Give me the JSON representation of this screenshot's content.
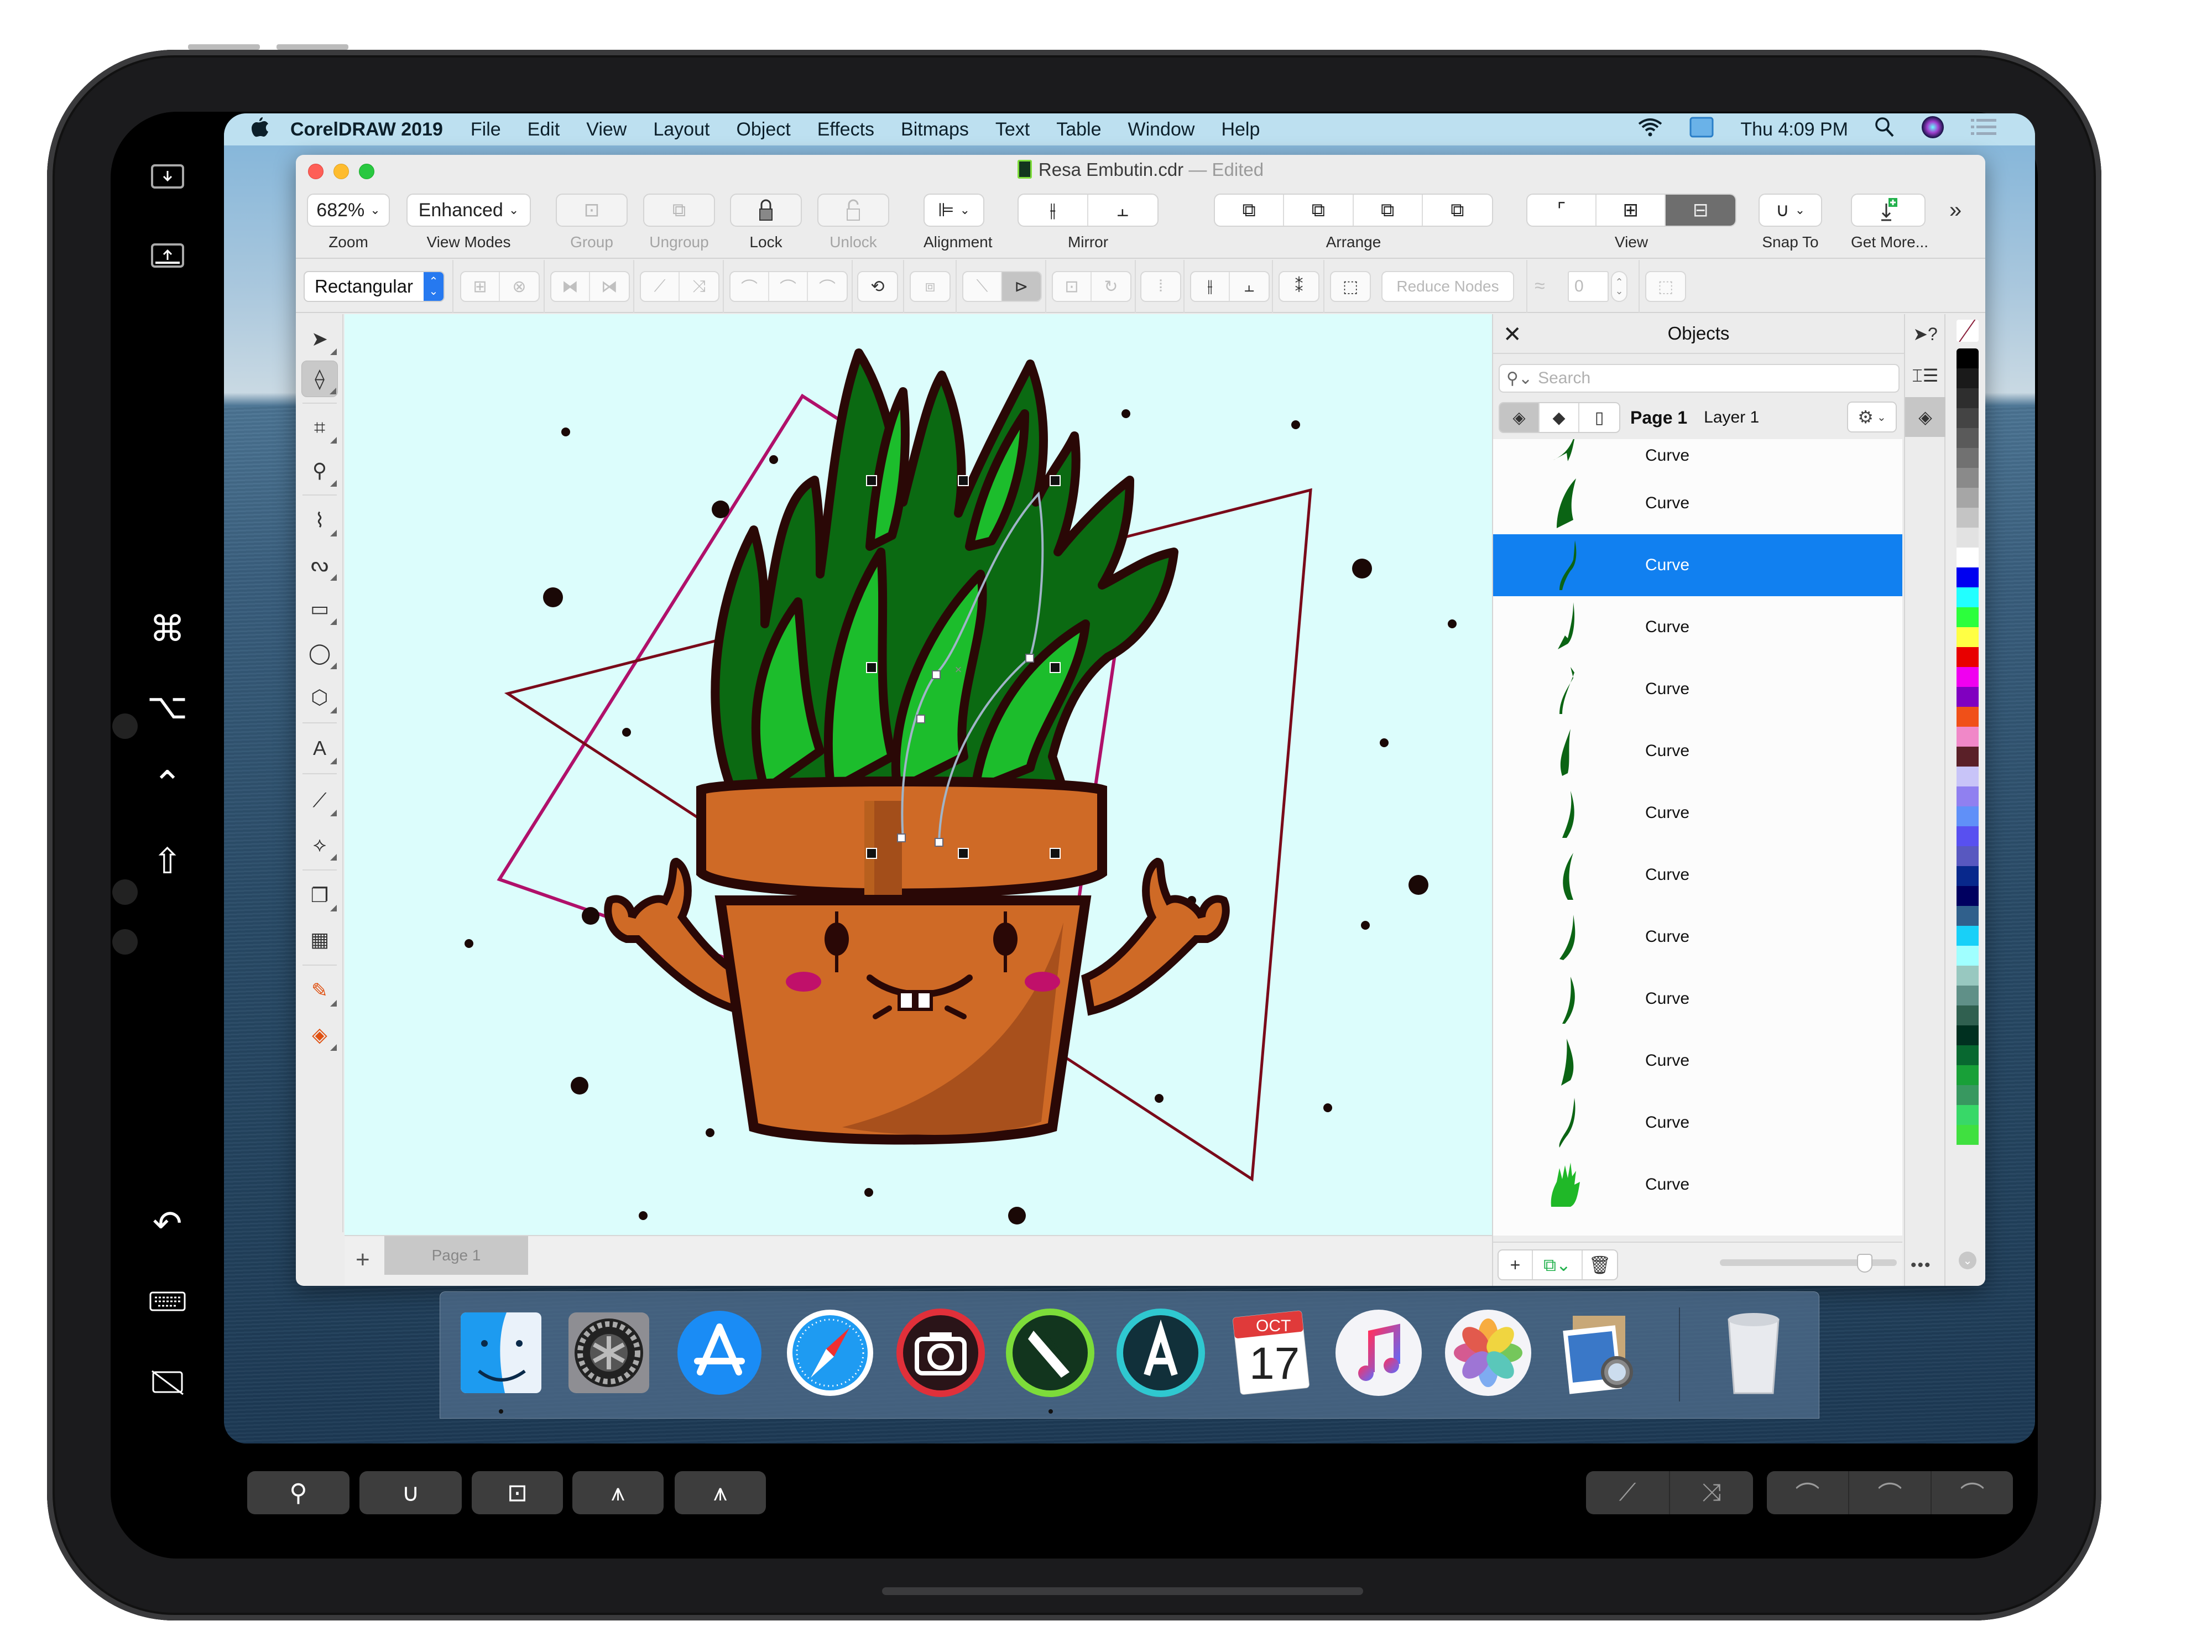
{
  "menubar": {
    "app_name": "CorelDRAW 2019",
    "items": [
      "File",
      "Edit",
      "View",
      "Layout",
      "Object",
      "Effects",
      "Bitmaps",
      "Text",
      "Table",
      "Window",
      "Help"
    ],
    "clock": "Thu 4:09 PM",
    "status_icons": [
      "wifi-icon",
      "display-icon",
      "spotlight-search-icon",
      "siri-icon",
      "notification-center-icon"
    ]
  },
  "window": {
    "document_name": "Resa Embutin.cdr",
    "separator": "—",
    "status": "Edited"
  },
  "toolbar": {
    "zoom_value": "682%",
    "zoom_label": "Zoom",
    "view_mode_value": "Enhanced",
    "view_modes_label": "View Modes",
    "group_label": "Group",
    "ungroup_label": "Ungroup",
    "lock_label": "Lock",
    "unlock_label": "Unlock",
    "alignment_label": "Alignment",
    "mirror_label": "Mirror",
    "arrange_label": "Arrange",
    "view_label": "View",
    "snap_label": "Snap To",
    "get_more_label": "Get More...",
    "overflow": "»"
  },
  "propbar": {
    "selection_mode": "Rectangular",
    "reduce_nodes_label": "Reduce Nodes",
    "smoothness_value": "0"
  },
  "canvas": {
    "background": "#dcfdfc",
    "page_tab": "Page 1",
    "add_page": "+"
  },
  "docker": {
    "title": "Objects",
    "close": "✕",
    "search_placeholder": "Search",
    "page_label": "Page 1",
    "layer_label": "Layer 1",
    "objects": [
      {
        "name": "Curve",
        "selected": false
      },
      {
        "name": "Curve",
        "selected": false
      },
      {
        "name": "Curve",
        "selected": true
      },
      {
        "name": "Curve",
        "selected": false
      },
      {
        "name": "Curve",
        "selected": false
      },
      {
        "name": "Curve",
        "selected": false
      },
      {
        "name": "Curve",
        "selected": false
      },
      {
        "name": "Curve",
        "selected": false
      },
      {
        "name": "Curve",
        "selected": false
      },
      {
        "name": "Curve",
        "selected": false
      },
      {
        "name": "Curve",
        "selected": false
      },
      {
        "name": "Curve",
        "selected": false
      },
      {
        "name": "Curve",
        "selected": false
      }
    ],
    "thumbnail_zoom": 0.85,
    "more": "•••"
  },
  "palette": {
    "colors": [
      "#000000",
      "#1a1a1a",
      "#2e2e2e",
      "#444444",
      "#5a5a5a",
      "#717171",
      "#8a8a8a",
      "#a6a6a6",
      "#c4c4c4",
      "#e2e2e2",
      "#ffffff",
      "#0000f0",
      "#22ffff",
      "#2cff3c",
      "#ffff44",
      "#e80000",
      "#f000f0",
      "#8000c0",
      "#f05018",
      "#f088c8",
      "#5a2028",
      "#c8c4f8",
      "#9080f0",
      "#6090f8",
      "#5850f0",
      "#5858c0",
      "#08288c",
      "#000060",
      "#30608c",
      "#18d0f8",
      "#a0ffff",
      "#98c8c0",
      "#609088",
      "#306050",
      "#003020",
      "#086830",
      "#18a038",
      "#389860",
      "#38d868",
      "#40e040"
    ]
  },
  "accent_colors": {
    "selection_blue": "#1180f0",
    "pot_orange": "#cf6a26",
    "leaf_green": "#1cbd2c",
    "leaf_dark": "#0b6a12",
    "outline": "#2a0806",
    "frame_magenta": "#b0106a"
  },
  "dock": {
    "apps": [
      "Finder",
      "System Preferences",
      "App Store",
      "Safari",
      "Photo Booth",
      "CorelDRAW",
      "Font Manager",
      "Calendar",
      "iTunes",
      "Photos",
      "Preview",
      "Trash"
    ],
    "calendar_month": "OCT",
    "calendar_day": "17"
  },
  "sidecar": {
    "icons": [
      "show-menu-bar-icon",
      "show-dock-icon",
      "command-key-icon",
      "option-key-icon",
      "control-key-icon",
      "shift-key-icon",
      "undo-icon",
      "keyboard-icon",
      "disconnect-icon"
    ]
  },
  "touchbar": {
    "left_keys": [
      "zoom-tool-icon",
      "snap-magnet-icon",
      "node-select-icon",
      "cusp-node-icon",
      "smooth-node-icon"
    ],
    "right_keys": [
      "to-line-icon",
      "to-curve-icon",
      "cusp-icon",
      "smooth-icon",
      "symmetrical-icon"
    ]
  }
}
